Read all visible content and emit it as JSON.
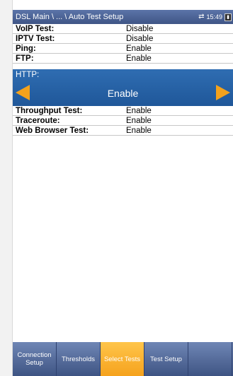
{
  "header": {
    "title": "DSL Main \\ ... \\ Auto Test Setup",
    "time": "15:49",
    "network_icon": "network-transfer-icon",
    "battery_icon": "battery-icon"
  },
  "rows_top": [
    {
      "label": "VoIP Test:",
      "value": "Disable"
    },
    {
      "label": "IPTV Test:",
      "value": "Disable"
    },
    {
      "label": "Ping:",
      "value": "Enable"
    },
    {
      "label": "FTP:",
      "value": "Enable"
    }
  ],
  "selected": {
    "label": "HTTP:",
    "value": "Enable",
    "accent": "#f4a21c"
  },
  "rows_bottom": [
    {
      "label": "Throughput Test:",
      "value": "Enable"
    },
    {
      "label": "Traceroute:",
      "value": "Enable"
    },
    {
      "label": "Web Browser Test:",
      "value": "Enable"
    }
  ],
  "tabs": [
    {
      "label": "Connection Setup"
    },
    {
      "label": "Thresholds"
    },
    {
      "label": "Select Tests"
    },
    {
      "label": "Test Setup"
    },
    {
      "label": ""
    }
  ],
  "colors": {
    "selected_bg": "#2566ab",
    "active_tab": "#f5a21d",
    "tab_bg": "#4a5f91"
  }
}
